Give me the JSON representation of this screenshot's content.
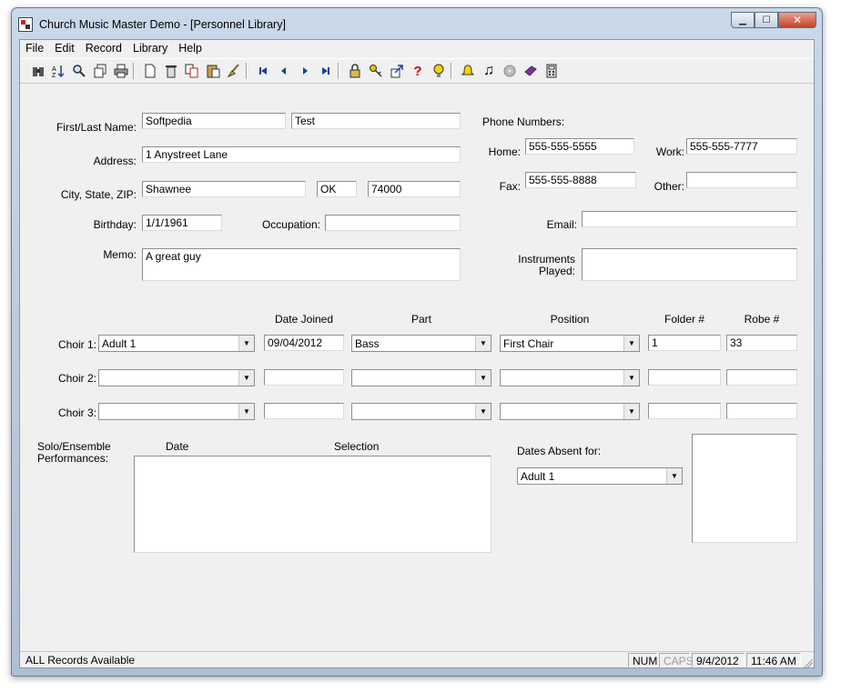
{
  "window": {
    "title": "Church Music Master Demo - [Personnel Library]"
  },
  "menu": [
    "File",
    "Edit",
    "Record",
    "Library",
    "Help"
  ],
  "toolbar_icons": [
    "binoculars-icon",
    "sort-icon",
    "magnifier-icon",
    "copy-record-icon",
    "print-icon",
    "new-icon",
    "delete-icon",
    "copy-icon",
    "paste-icon",
    "broom-icon",
    "first-record-icon",
    "previous-record-icon",
    "next-record-icon",
    "last-record-icon",
    "lock-icon",
    "key-icon",
    "export-icon",
    "help-icon",
    "tip-icon",
    "bell-icon",
    "music-note-icon",
    "cd-icon",
    "book-icon",
    "calculator-icon"
  ],
  "form": {
    "labels": {
      "name": "First/Last Name:",
      "address": "Address:",
      "city_state_zip": "City, State, ZIP:",
      "birthday": "Birthday:",
      "occupation": "Occupation:",
      "memo": "Memo:",
      "phone_numbers": "Phone Numbers:",
      "home": "Home:",
      "work": "Work:",
      "fax": "Fax:",
      "other": "Other:",
      "email": "Email:",
      "instruments_1": "Instruments",
      "instruments_2": "Played:"
    },
    "first_name": "Softpedia",
    "last_name": "Test",
    "address": "1 Anystreet Lane",
    "city": "Shawnee",
    "state": "OK",
    "zip": "74000",
    "birthday": "1/1/1961",
    "occupation": "",
    "memo": "A great guy",
    "home_phone": "555-555-5555",
    "work_phone": "555-555-7777",
    "fax": "555-555-8888",
    "other_phone": "",
    "email": "",
    "instruments": ""
  },
  "choirs": {
    "headers": {
      "date_joined": "Date Joined",
      "part": "Part",
      "position": "Position",
      "folder": "Folder #",
      "robe": "Robe #"
    },
    "rows": [
      {
        "label": "Choir 1:",
        "choir": "Adult 1",
        "date_joined": "09/04/2012",
        "part": "Bass",
        "position": "First Chair",
        "folder": "1",
        "robe": "33"
      },
      {
        "label": "Choir 2:",
        "choir": "",
        "date_joined": "",
        "part": "",
        "position": "",
        "folder": "",
        "robe": ""
      },
      {
        "label": "Choir 3:",
        "choir": "",
        "date_joined": "",
        "part": "",
        "position": "",
        "folder": "",
        "robe": ""
      }
    ]
  },
  "performances": {
    "label_1": "Solo/Ensemble",
    "label_2": "Performances:",
    "date_header": "Date",
    "selection_header": "Selection"
  },
  "absences": {
    "label": "Dates Absent for:",
    "selected": "Adult 1"
  },
  "status": {
    "message": "ALL Records Available",
    "num": "NUM",
    "caps": "CAPS",
    "date": "9/4/2012",
    "time": "11:46 AM"
  }
}
